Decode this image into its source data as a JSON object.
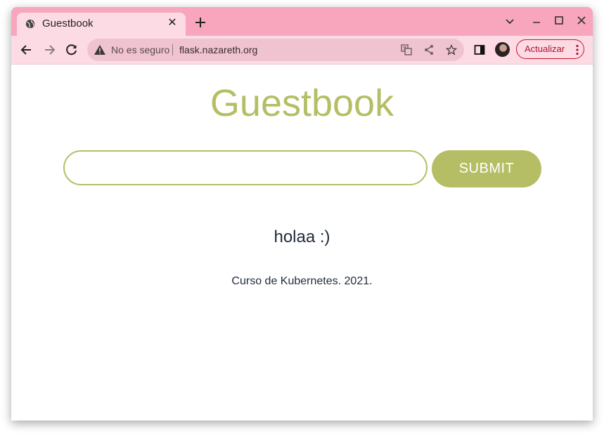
{
  "browser": {
    "tab": {
      "title": "Guestbook"
    },
    "address_bar": {
      "security_label": "No es seguro",
      "url": "flask.nazareth.org"
    },
    "update_button_label": "Actualizar",
    "accent_color": "#f7a6bd",
    "toolbar_color": "#fddbe5"
  },
  "page": {
    "title": "Guestbook",
    "input": {
      "value": "",
      "placeholder": ""
    },
    "submit_label": "SUBMIT",
    "entries": [
      "holaa :)"
    ],
    "footer": "Curso de Kubernetes. 2021.",
    "accent_color": "#b5be64"
  }
}
